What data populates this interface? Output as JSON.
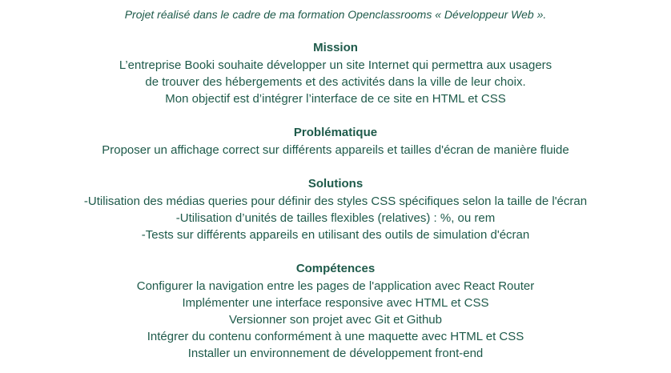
{
  "intro": "Projet réalisé dans le cadre de ma formation Openclassrooms « Développeur Web ».",
  "mission": {
    "title": "Mission",
    "lines": [
      "L’entreprise Booki souhaite développer un site Internet qui permettra aux usagers",
      "de trouver des hébergements et des activités dans la ville de leur choix.",
      "Mon objectif est d’intégrer l’interface de ce site en HTML et CSS"
    ]
  },
  "problematique": {
    "title": "Problématique",
    "lines": [
      "Proposer un affichage correct sur différents appareils et tailles d'écran de manière fluide"
    ]
  },
  "solutions": {
    "title": "Solutions",
    "lines": [
      "-Utilisation des médias queries pour définir des styles CSS spécifiques selon la taille de l'écran",
      "-Utilisation d’unités de tailles flexibles (relatives) : %, ou rem",
      "-Tests sur différents appareils en utilisant des outils de simulation d'écran"
    ]
  },
  "competences": {
    "title": "Compétences",
    "lines": [
      "Configurer la navigation entre les pages de l'application avec React Router",
      "Implémenter une interface responsive avec HTML et CSS",
      "Versionner son projet avec Git et Github",
      "Intégrer du contenu conformément à une maquette avec HTML et CSS",
      "Installer un environnement de développement front-end"
    ]
  },
  "colors": {
    "text": "#1e5a4a",
    "background": "#ffffff"
  }
}
